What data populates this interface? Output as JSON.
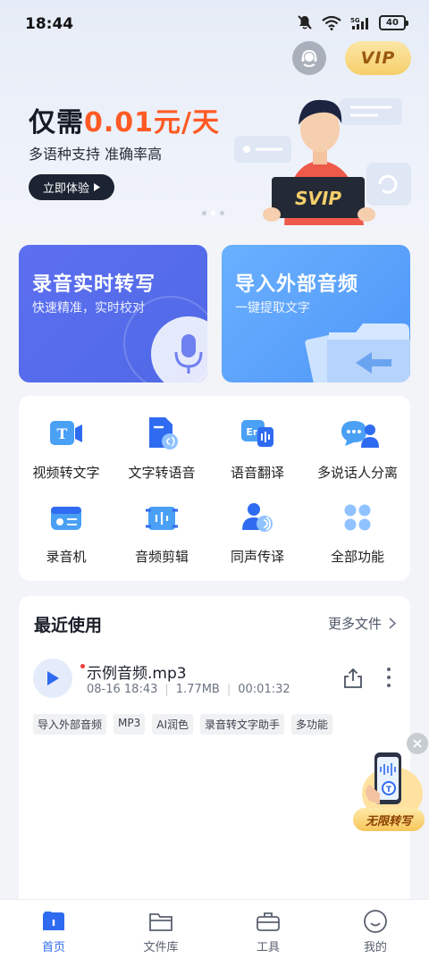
{
  "status_bar": {
    "time": "18:44",
    "battery": "40"
  },
  "header": {
    "vip_label": "VIP"
  },
  "banner": {
    "title_prefix": "仅需",
    "title_price": "0.01元/天",
    "subtitle": "多语种支持 准确率高",
    "cta_label": "立即体验",
    "badge_text": "SVIP"
  },
  "quick_actions": [
    {
      "title": "录音实时转写",
      "subtitle": "快速精准，实时校对"
    },
    {
      "title": "导入外部音频",
      "subtitle": "一键提取文字"
    }
  ],
  "functions": [
    {
      "label": "视频转文字",
      "icon": "video-text-icon"
    },
    {
      "label": "文字转语音",
      "icon": "text-to-speech-icon"
    },
    {
      "label": "语音翻译",
      "icon": "translate-icon"
    },
    {
      "label": "多说话人分离",
      "icon": "speakers-icon"
    },
    {
      "label": "录音机",
      "icon": "recorder-icon"
    },
    {
      "label": "音频剪辑",
      "icon": "audio-edit-icon"
    },
    {
      "label": "同声传译",
      "icon": "simultaneous-interpret-icon"
    },
    {
      "label": "全部功能",
      "icon": "all-features-icon"
    }
  ],
  "recent": {
    "title": "最近使用",
    "more_label": "更多文件",
    "file": {
      "name": "示例音频.mp3",
      "date": "08-16 18:43",
      "size": "1.77MB",
      "duration": "00:01:32",
      "tags": [
        "导入外部音频",
        "MP3",
        "AI润色",
        "录音转文字助手",
        "多功能"
      ]
    }
  },
  "float_promo": {
    "label": "无限转写"
  },
  "bottom_nav": [
    {
      "label": "首页",
      "active": true
    },
    {
      "label": "文件库",
      "active": false
    },
    {
      "label": "工具",
      "active": false
    },
    {
      "label": "我的",
      "active": false
    }
  ],
  "colors": {
    "primary": "#2f6bf0",
    "accent": "#ff5a24",
    "card_blue": "#5a6eee",
    "card_light_blue": "#5aa4fc"
  }
}
